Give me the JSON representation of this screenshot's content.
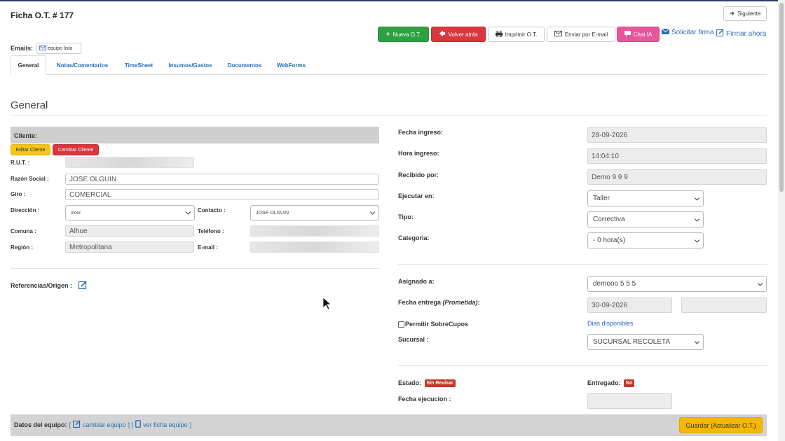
{
  "header": {
    "title": "Ficha O.T. # 177",
    "next_label": "Siguiente"
  },
  "actions": {
    "nueva": "Nueva O.T.",
    "volver": "Volver atrás",
    "imprimir": "Imprimir O.T.",
    "enviar": "Enviar por E-mail",
    "chat": "Chat IA",
    "solicitar": "Solicitar firma",
    "firmar": "Firmar ahora"
  },
  "emails": {
    "label": "Emails:",
    "chip": "equipo listo"
  },
  "tabs": [
    "General",
    "Notas/Comentarios",
    "TimeSheet",
    "Insumos/Gastos",
    "Documentos",
    "WebForms"
  ],
  "section_title": "General",
  "cliente": {
    "header": "Cliente:",
    "editar": "Editar Cliente",
    "cambiar": "Cambiar Cliente",
    "rut_label": "R.U.T. :",
    "razon_label": "Razón Social :",
    "razon_value": "JOSE OLGUIN",
    "giro_label": "Giro :",
    "giro_value": "COMERCIAL",
    "direccion_label": "Dirección :",
    "direccion_value": "xxxx",
    "contacto_label": "Contacto :",
    "contacto_value": "JOSE OLGUIN",
    "comuna_label": "Comuna :",
    "comuna_value": "Alhue",
    "telefono_label": "Teléfono :",
    "region_label": "Región :",
    "region_value": "Metropolitana",
    "email_label": "E-mail :"
  },
  "referencias_label": "Referencias/Origen :",
  "right": {
    "fecha_ingreso_label": "Fecha ingreso:",
    "fecha_ingreso": "28-09-2026",
    "hora_ingreso_label": "Hora ingreso:",
    "hora_ingreso": "14:04:10",
    "recibido_label": "Recibido por:",
    "recibido": "Demo 9 9 9",
    "ejecutar_label": "Ejecutar en:",
    "ejecutar": "Taller",
    "tipo_label": "Tipo:",
    "tipo": "Correctiva",
    "categoria_label": "Categoria:",
    "categoria": "- 0 hora(s)",
    "asignado_label": "Asignado a:",
    "asignado": "demooo 5 5 5",
    "fecha_entrega_label": "Fecha entrega",
    "fecha_entrega_note": "(Prometida)",
    "fecha_entrega_colon": ":",
    "fecha_entrega": "30-09-2026",
    "sobrecupos_label": "Permitir SobreCupos",
    "dias_label": "Dias disponibles",
    "sucursal_label": "Sucursal :",
    "sucursal": "SUCURSAL RECOLETA",
    "estado_label": "Estado:",
    "estado_badge": "Sin Revisar",
    "entregado_label": "Entregado:",
    "entregado_badge": "No",
    "fecha_ejecucion_label": "Fecha ejecucion :"
  },
  "footer": {
    "datos_label": "Datos del equipo:",
    "bracket_open": "[",
    "cambiar_equipo": "cambiar equipo",
    "bracket_mid": "] [",
    "ver_ficha": "ver ficha equipo",
    "bracket_close": "]",
    "guardar": "Guardar (Actualizar O.T.)"
  },
  "colors": {
    "green": "#2ea043",
    "red": "#d9363e",
    "pink": "#e8559b",
    "yellow": "#f5c518",
    "orange": "#f0ad4e",
    "link": "#2a6db5",
    "badge_red": "#c0392b"
  }
}
